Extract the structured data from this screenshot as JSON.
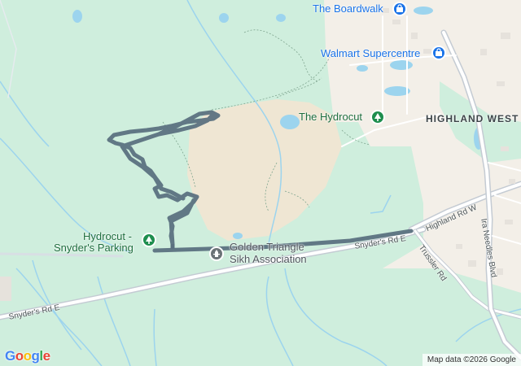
{
  "map": {
    "places": {
      "boardwalk": "The Boardwalk",
      "walmart": "Walmart Supercentre",
      "hydrocut": "The Hydrocut",
      "highland_west": "HIGHLAND WEST",
      "parking_line1": "Hydrocut -",
      "parking_line2": "Snyder's Parking",
      "sikh_line1": "Golden Triangle",
      "sikh_line2": "Sikh Association"
    },
    "streets": {
      "snyders_center": "Snyder's Rd E",
      "snyders_west": "Snyder's Rd E",
      "highland_rd": "Highland Rd W",
      "trussler_rd": "Trussler Rd",
      "ira_needles": "Ira Needles Blvd"
    },
    "icons": {
      "shopping": "shopping-bag-icon",
      "park": "tree-icon",
      "worship": "place-of-worship-icon"
    },
    "logo_letters": [
      "G",
      "o",
      "o",
      "g",
      "l",
      "e"
    ],
    "logo_colors": [
      "#4285F4",
      "#EA4335",
      "#FBBC05",
      "#4285F4",
      "#34A853",
      "#EA4335"
    ],
    "attribution": "Map data ©2026 Google",
    "colors": {
      "park": "#cfeedd",
      "urban": "#f3efe8",
      "clearing": "#efe6d3",
      "water": "#9cd4ee",
      "road": "#c4cbd3",
      "route": "#5b7180"
    }
  }
}
